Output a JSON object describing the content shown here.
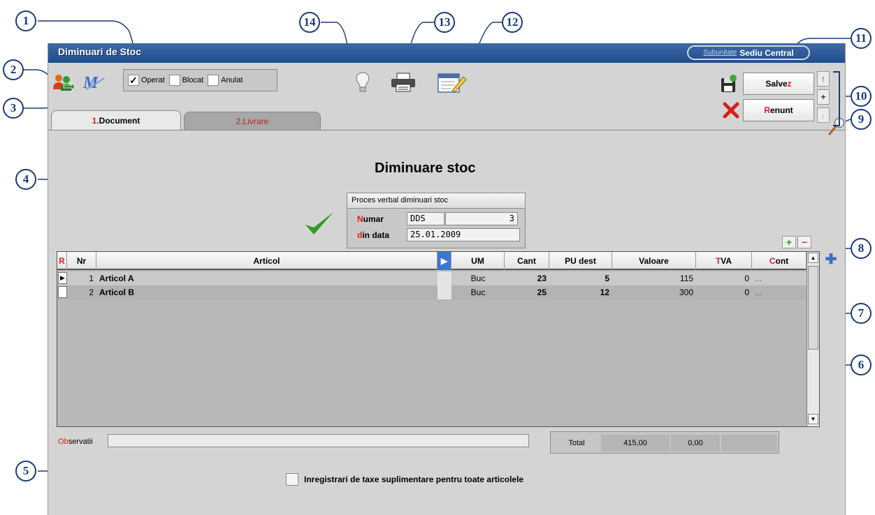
{
  "window": {
    "title": "Diminuari de Stoc",
    "subunit_label": "Subunitate",
    "subunit_value": "Sediu Central"
  },
  "toolbar": {
    "states": [
      {
        "label": "Operat",
        "checked": true
      },
      {
        "label": "Blocat",
        "checked": false
      },
      {
        "label": "Anulat",
        "checked": false
      }
    ],
    "save": {
      "hot": "",
      "pre": "Salve",
      "post": "z",
      "hotkey": "z"
    },
    "cancel": {
      "pre": "",
      "hot": "R",
      "post": "enunt"
    }
  },
  "tabs": [
    {
      "num": "1.",
      "label": "Document",
      "active": true
    },
    {
      "num": "2.",
      "label": "Livrare",
      "active": false
    }
  ],
  "document": {
    "heading": "Diminuare stoc",
    "pv_title": "Proces verbal diminuari stoc",
    "numar_label_hot": "N",
    "numar_label_rest": "umar",
    "numar_series": "DDS",
    "numar_value": "3",
    "data_label_hot": "d",
    "data_label_rest": "in data",
    "data_value": "25.01.2009"
  },
  "grid": {
    "headers": {
      "r": "R",
      "nr": "Nr",
      "articol": "Articol",
      "um": "UM",
      "cant": "Cant",
      "pu": "PU dest",
      "valoare": "Valoare",
      "tva_hot": "T",
      "tva_rest": "VA",
      "cont_hot": "C",
      "cont_rest": "ont"
    },
    "rows": [
      {
        "nr": "1",
        "articol": "Articol A",
        "um": "Buc",
        "cant": "23",
        "pu": "5",
        "valoare": "115",
        "tva": "0",
        "cont": "..."
      },
      {
        "nr": "2",
        "articol": "Articol B",
        "um": "Buc",
        "cant": "25",
        "pu": "12",
        "valoare": "300",
        "tva": "0",
        "cont": "..."
      }
    ]
  },
  "footer": {
    "obs_hot": "Ob",
    "obs_rest": "servatii",
    "total_label": "Total",
    "total_value": "415,00",
    "total_tva": "0,00",
    "extra_taxes_label": "Inregistrari de taxe suplimentare pentru toate articolele"
  },
  "callouts": [
    "1",
    "2",
    "3",
    "4",
    "5",
    "6",
    "7",
    "8",
    "9",
    "10",
    "11",
    "12",
    "13",
    "14"
  ],
  "colors": {
    "titlebar": "#1f4c8c",
    "hotkey": "#e02020",
    "callout": "#1a3a7a",
    "check_green": "#2e9e1e"
  }
}
